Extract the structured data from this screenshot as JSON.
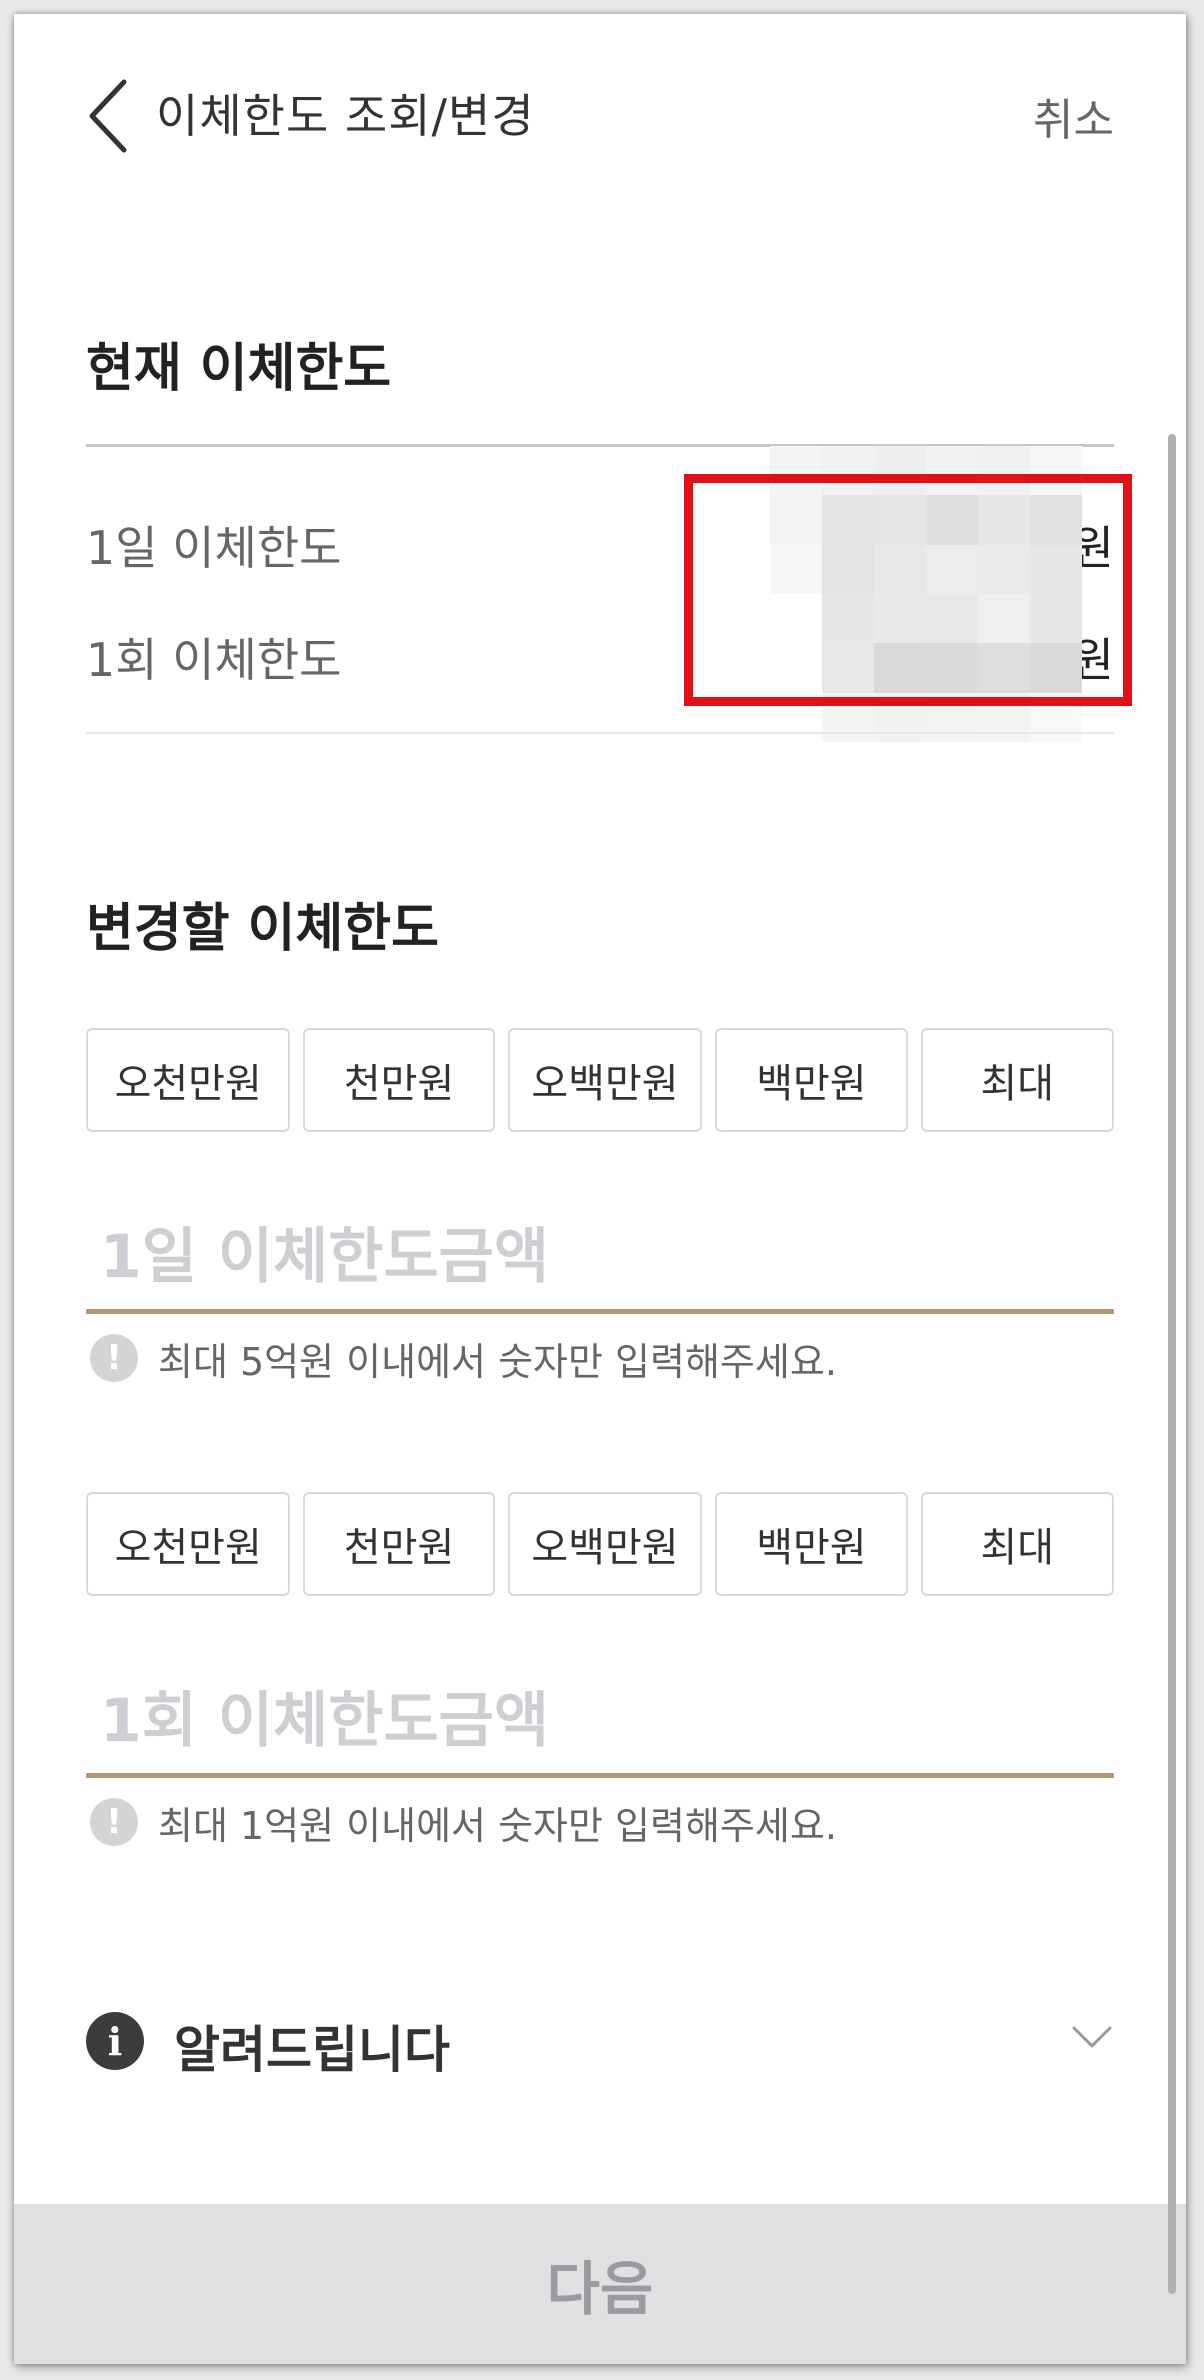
{
  "header": {
    "back_icon": "chevron-left-icon",
    "title": "이체한도 조회/변경",
    "cancel_label": "취소"
  },
  "current": {
    "title": "현재 이체한도",
    "rows": [
      {
        "label": "1일 이체한도",
        "value": "",
        "unit": "원"
      },
      {
        "label": "1회 이체한도",
        "value": "",
        "unit": "원"
      }
    ]
  },
  "change": {
    "title": "변경할 이체한도",
    "daily": {
      "quick_buttons": [
        "오천만원",
        "천만원",
        "오백만원",
        "백만원",
        "최대"
      ],
      "placeholder": "1일 이체한도금액",
      "hint": "최대 5억원 이내에서 숫자만 입력해주세요."
    },
    "once": {
      "quick_buttons": [
        "오천만원",
        "천만원",
        "오백만원",
        "백만원",
        "최대"
      ],
      "placeholder": "1회 이체한도금액",
      "hint": "최대 1억원 이내에서 숫자만 입력해주세요."
    }
  },
  "notice": {
    "icon": "info-icon",
    "label": "알려드립니다",
    "toggle_icon": "chevron-down-icon"
  },
  "footer": {
    "next_label": "다음"
  },
  "colors": {
    "accent_underline": "#b39a74",
    "redaction_box": "#e01217",
    "button_disabled_bg": "#dfe0e2"
  }
}
